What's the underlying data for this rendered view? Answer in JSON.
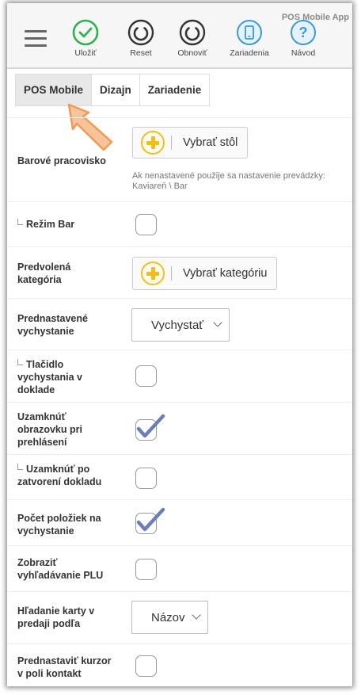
{
  "app": {
    "title": "POS Mobile App"
  },
  "toolbar": {
    "save": "Uložiť",
    "reset": "Reset",
    "refresh": "Obnoviť",
    "devices": "Zariadenia",
    "help": "Návod"
  },
  "tabs": [
    {
      "label": "POS Mobile",
      "active": true
    },
    {
      "label": "Dizajn",
      "active": false
    },
    {
      "label": "Zariadenie",
      "active": false
    }
  ],
  "settings": {
    "bar_station": {
      "label": "Barové pracovisko",
      "button": "Vybrať stôl",
      "hint": "Ak nenastavené použije sa nastavenie prevádzky: Kaviareň \\ Bar"
    },
    "bar_mode": {
      "label": "Režim Bar",
      "checked": false
    },
    "default_category": {
      "label": "Predvolená kategória",
      "button": "Vybrať kategóriu"
    },
    "default_dispatch": {
      "label": "Prednastavené vychystanie",
      "value": "Vychystať"
    },
    "dispatch_button": {
      "label": "Tlačidlo vychystania v doklade",
      "checked": false
    },
    "lock_screen": {
      "label": "Uzamknúť obrazovku pri prehlásení",
      "checked": true
    },
    "lock_after_close": {
      "label": "Uzamknúť po zatvorení dokladu",
      "checked": false
    },
    "items_count": {
      "label": "Počet položiek na vychystanie",
      "checked": true
    },
    "plu_search": {
      "label": "Zobraziť vyhľadávanie PLU",
      "checked": false
    },
    "card_search": {
      "label": "Hľadanie karty v predaji podľa",
      "value": "Názov"
    },
    "cursor_contact": {
      "label": "Prednastaviť kurzor v poli kontakt",
      "checked": false
    }
  },
  "colors": {
    "save_green": "#2db34a",
    "dark_icon": "#333333",
    "blue_icon": "#3a9ad9",
    "plus_yellow": "#f3be12",
    "check_blue": "#6a7fb5",
    "arrow_orange": "#f6a463"
  }
}
